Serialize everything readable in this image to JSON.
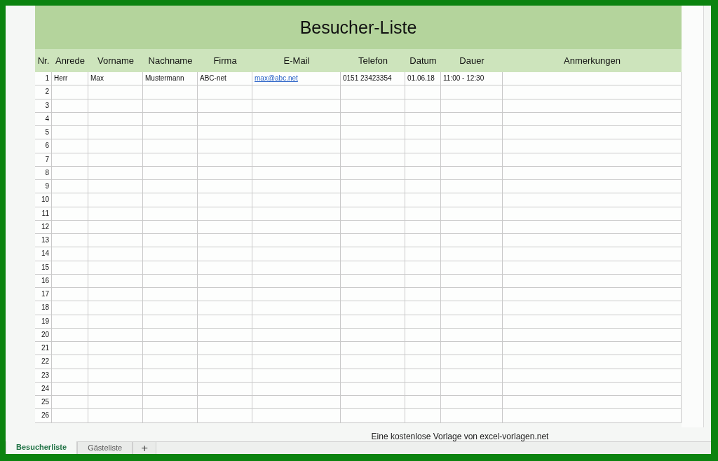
{
  "sheet": {
    "title": "Besucher-Liste"
  },
  "table": {
    "columns": [
      "Nr.",
      "Anrede",
      "Vorname",
      "Nachname",
      "Firma",
      "E-Mail",
      "Telefon",
      "Datum",
      "Dauer",
      "Anmerkungen"
    ],
    "rows": [
      {
        "cells": [
          "1",
          "Herr",
          "Max",
          "Mustermann",
          "ABC-net",
          "max@abc.net",
          "0151 23423354",
          "01.06.18",
          "11:00 - 12:30"
        ]
      },
      {
        "cells": [
          "2"
        ]
      },
      {
        "cells": [
          "3"
        ]
      },
      {
        "cells": [
          "4"
        ]
      },
      {
        "cells": [
          "5"
        ]
      },
      {
        "cells": [
          "6"
        ]
      },
      {
        "cells": [
          "7"
        ]
      },
      {
        "cells": [
          "8"
        ]
      },
      {
        "cells": [
          "9"
        ]
      },
      {
        "cells": [
          "10"
        ]
      },
      {
        "cells": [
          "11"
        ]
      },
      {
        "cells": [
          "12"
        ]
      },
      {
        "cells": [
          "13"
        ]
      },
      {
        "cells": [
          "14"
        ]
      },
      {
        "cells": [
          "15"
        ]
      },
      {
        "cells": [
          "16"
        ]
      },
      {
        "cells": [
          "17"
        ]
      },
      {
        "cells": [
          "18"
        ]
      },
      {
        "cells": [
          "19"
        ]
      },
      {
        "cells": [
          "20"
        ]
      },
      {
        "cells": [
          "21"
        ]
      },
      {
        "cells": [
          "22"
        ]
      },
      {
        "cells": [
          "23"
        ]
      },
      {
        "cells": [
          "24"
        ]
      },
      {
        "cells": [
          "25"
        ]
      },
      {
        "cells": [
          "26"
        ]
      }
    ]
  },
  "footer_note": "Eine kostenlose Vorlage von excel-vorlagen.net",
  "sheet_tabs": [
    {
      "label": "Besucherliste",
      "selected": true
    },
    {
      "label": "Gästeliste",
      "selected": false
    }
  ],
  "add_sheet": "+"
}
